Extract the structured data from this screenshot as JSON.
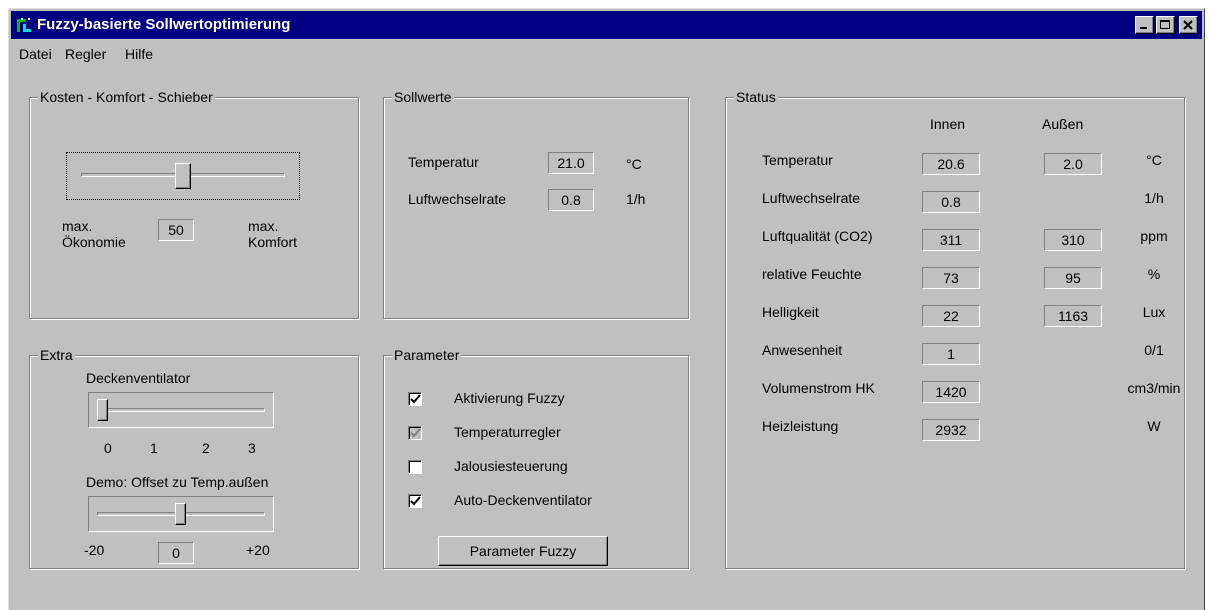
{
  "window": {
    "title": "Fuzzy-basierte Sollwertoptimierung"
  },
  "menu": [
    {
      "label": "Datei"
    },
    {
      "label": "Regler"
    },
    {
      "label": "Hilfe"
    }
  ],
  "kosten": {
    "legend": "Kosten - Komfort - Schieber",
    "value": "50",
    "slider_fraction": 0.5,
    "left_label_1": "max.",
    "left_label_2": "Ökonomie",
    "right_label_1": "max.",
    "right_label_2": "Komfort"
  },
  "sollwerte": {
    "legend": "Sollwerte",
    "rows": [
      {
        "label": "Temperatur",
        "value": "21.0",
        "unit": "°C"
      },
      {
        "label": "Luftwechselrate",
        "value": "0.8",
        "unit": "1/h"
      }
    ]
  },
  "status": {
    "legend": "Status",
    "col_inside": "Innen",
    "col_outside": "Außen",
    "rows": [
      {
        "label": "Temperatur",
        "inside": "20.6",
        "outside": "2.0",
        "unit": "°C"
      },
      {
        "label": "Luftwechselrate",
        "inside": "0.8",
        "outside": "",
        "unit": "1/h"
      },
      {
        "label": "Luftqualität (CO2)",
        "inside": "311",
        "outside": "310",
        "unit": "ppm"
      },
      {
        "label": "relative Feuchte",
        "inside": "73",
        "outside": "95",
        "unit": "%"
      },
      {
        "label": "Helligkeit",
        "inside": "22",
        "outside": "1163",
        "unit": "Lux"
      },
      {
        "label": "Anwesenheit",
        "inside": "1",
        "outside": "",
        "unit": "0/1"
      },
      {
        "label": "Volumenstrom HK",
        "inside": "1420",
        "outside": "",
        "unit": "cm3/min"
      },
      {
        "label": "Heizleistung",
        "inside": "2932",
        "outside": "",
        "unit": "W"
      }
    ]
  },
  "extra": {
    "legend": "Extra",
    "fan_label": "Deckenventilator",
    "fan_ticks": [
      "0",
      "1",
      "2",
      "3"
    ],
    "fan_level": 0,
    "demo_label": "Demo: Offset zu Temp.außen",
    "demo_min": "-20",
    "demo_max": "+20",
    "demo_value": "0"
  },
  "parameter": {
    "legend": "Parameter",
    "options": [
      {
        "label": "Aktivierung Fuzzy",
        "checked": true,
        "enabled": true
      },
      {
        "label": "Temperaturregler",
        "checked": true,
        "enabled": false
      },
      {
        "label": "Jalousiesteuerung",
        "checked": false,
        "enabled": true
      },
      {
        "label": "Auto-Deckenventilator",
        "checked": true,
        "enabled": true
      }
    ],
    "button_label": "Parameter Fuzzy"
  }
}
